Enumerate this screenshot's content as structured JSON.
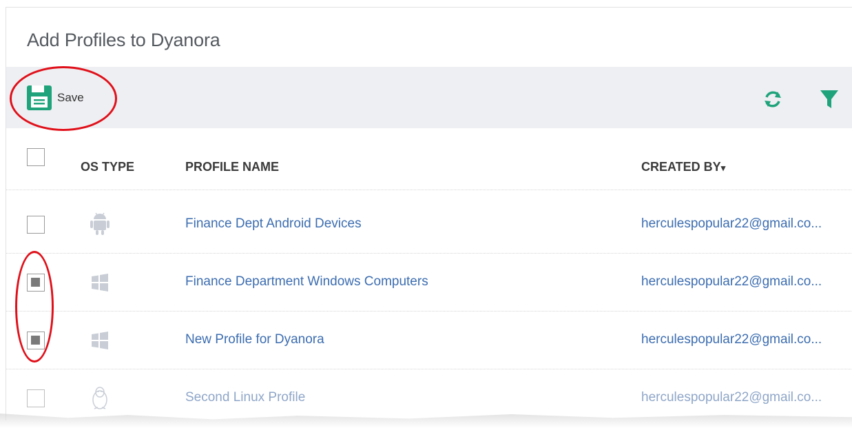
{
  "title": "Add Profiles to Dyanora",
  "toolbar": {
    "save_label": "Save",
    "save_icon": "floppy-disk-icon",
    "refresh_icon": "refresh-icon",
    "filter_icon": "filter-icon",
    "accent_color": "#1fa37a"
  },
  "table": {
    "headers": {
      "os_type": "OS TYPE",
      "profile_name": "PROFILE NAME",
      "created_by": "CREATED BY",
      "sort_indicator": "▾"
    },
    "rows": [
      {
        "checked": false,
        "os": "android-icon",
        "name": "Finance Dept Android Devices",
        "created_by": "herculespopular22@gmail.co..."
      },
      {
        "checked": true,
        "os": "windows-icon",
        "name": "Finance Department Windows Computers",
        "created_by": "herculespopular22@gmail.co..."
      },
      {
        "checked": true,
        "os": "windows-icon",
        "name": "New Profile for Dyanora",
        "created_by": "herculespopular22@gmail.co..."
      },
      {
        "checked": false,
        "os": "linux-icon",
        "name": "Second Linux Profile",
        "created_by": "herculespopular22@gmail.co..."
      }
    ]
  }
}
